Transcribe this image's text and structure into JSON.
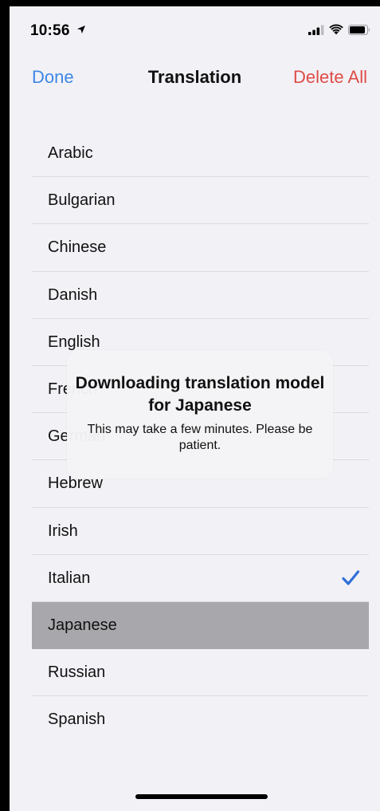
{
  "status_bar": {
    "time": "10:56",
    "location_icon": "location-arrow-icon",
    "signal_icon": "cellular-signal-icon",
    "wifi_icon": "wifi-icon",
    "battery_icon": "battery-icon"
  },
  "nav": {
    "done_label": "Done",
    "title": "Translation",
    "delete_all_label": "Delete All"
  },
  "languages": [
    {
      "label": "Arabic"
    },
    {
      "label": "Bulgarian"
    },
    {
      "label": "Chinese"
    },
    {
      "label": "Danish"
    },
    {
      "label": "English"
    },
    {
      "label": "French"
    },
    {
      "label": "German"
    },
    {
      "label": "Hebrew"
    },
    {
      "label": "Irish"
    },
    {
      "label": "Italian",
      "checked": true
    },
    {
      "label": "Japanese",
      "selected": true
    },
    {
      "label": "Russian"
    },
    {
      "label": "Spanish"
    }
  ],
  "toast": {
    "title": "Downloading translation model for Japanese",
    "message": "This may take a few minutes. Please be patient."
  },
  "colors": {
    "accent_blue": "#3e88e6",
    "destructive_red": "#df4c47",
    "background": "#f2f1f6",
    "selected_row": "#a8a8ac",
    "checkmark": "#2f6fd6"
  }
}
